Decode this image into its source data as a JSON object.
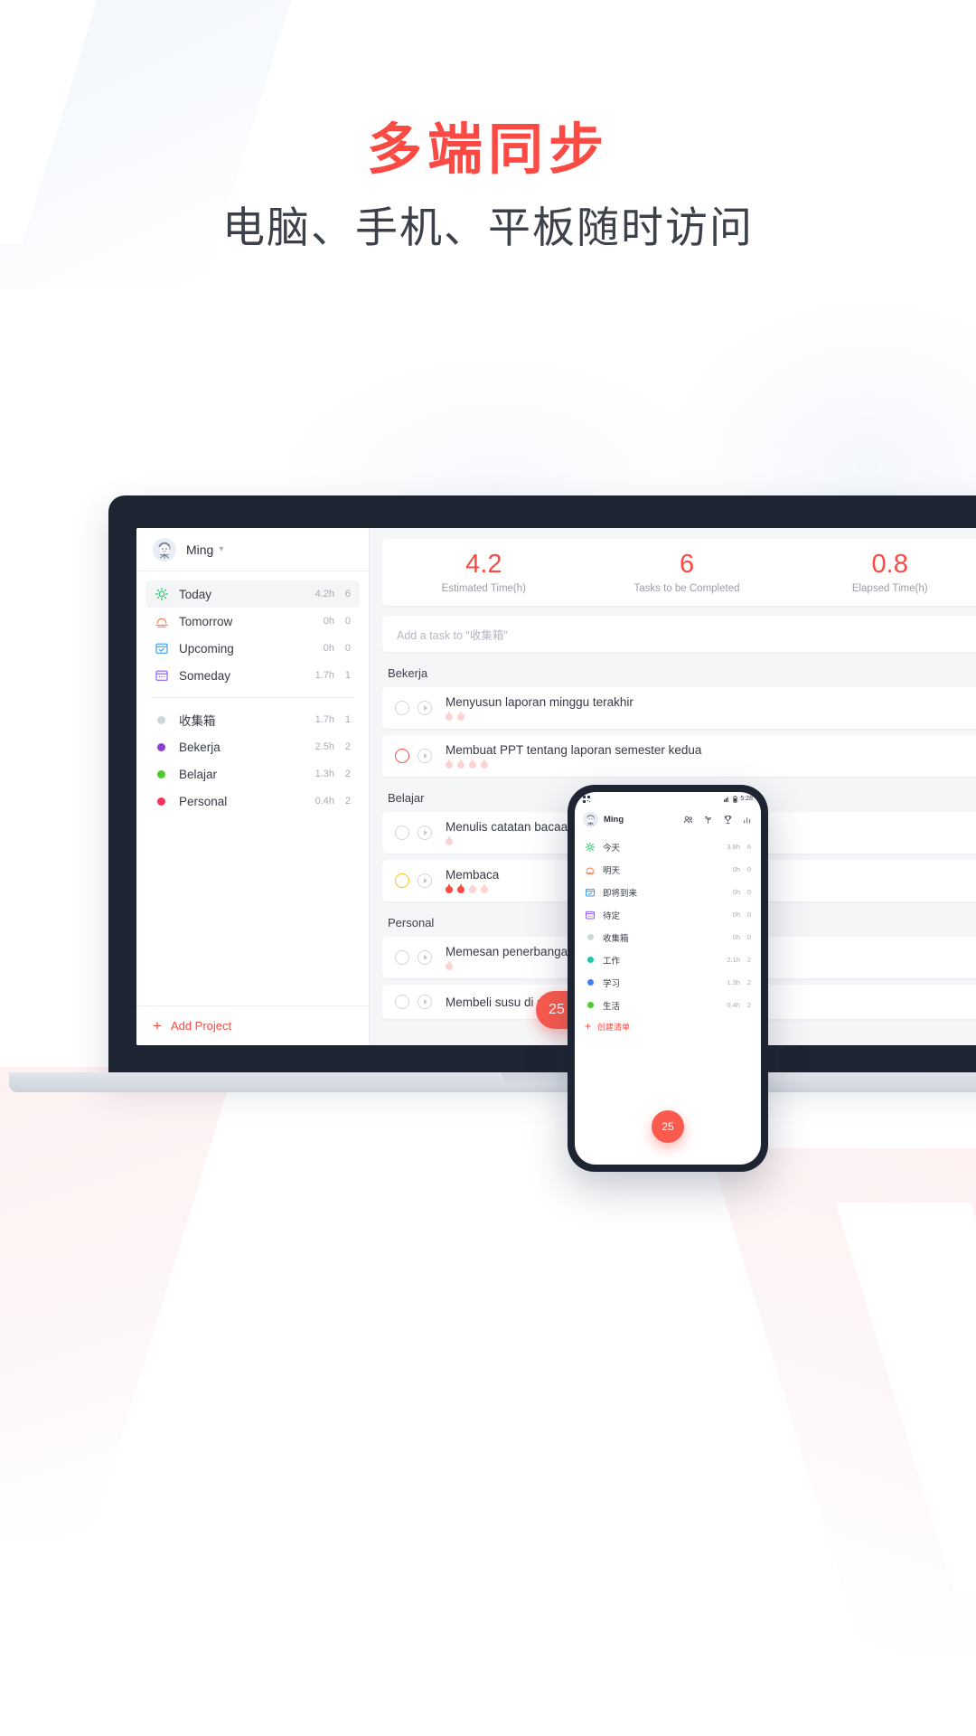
{
  "hero": {
    "title": "多端同步",
    "subtitle": "电脑、手机、平板随时访问"
  },
  "desktop": {
    "user": {
      "name": "Ming",
      "caret": "chevron-down-icon"
    },
    "smart_lists": [
      {
        "label": "Today",
        "icon": "sun-icon",
        "time": "4.2h",
        "count": "6",
        "active": true
      },
      {
        "label": "Tomorrow",
        "icon": "sunset-icon",
        "time": "0h",
        "count": "0",
        "active": false
      },
      {
        "label": "Upcoming",
        "icon": "calendar-check-icon",
        "time": "0h",
        "count": "0",
        "active": false
      },
      {
        "label": "Someday",
        "icon": "calendar-icon",
        "time": "1.7h",
        "count": "1",
        "active": false
      }
    ],
    "projects": [
      {
        "label": "收集箱",
        "color": "#ccd9db",
        "time": "1.7h",
        "count": "1"
      },
      {
        "label": "Bekerja",
        "color": "#8b3fd6",
        "time": "2.5h",
        "count": "2"
      },
      {
        "label": "Belajar",
        "color": "#4fcb2f",
        "time": "1.3h",
        "count": "2"
      },
      {
        "label": "Personal",
        "color": "#f7315e",
        "time": "0.4h",
        "count": "2"
      }
    ],
    "add_project": "Add Project",
    "stats": [
      {
        "value": "4.2",
        "caption": "Estimated Time(h)"
      },
      {
        "value": "6",
        "caption": "Tasks to be Completed"
      },
      {
        "value": "0.8",
        "caption": "Elapsed Time(h)"
      }
    ],
    "add_task_placeholder": "Add a task to \"收集箱\"",
    "groups": [
      {
        "title": "Bekerja",
        "tasks": [
          {
            "name": "Menyusun laporan minggu terakhir",
            "check": "grey",
            "pomodoros": 2,
            "filled": 0
          },
          {
            "name": "Membuat PPT tentang laporan semester kedua",
            "check": "red",
            "pomodoros": 4,
            "filled": 0
          }
        ]
      },
      {
        "title": "Belajar",
        "tasks": [
          {
            "name": "Menulis catatan bacaan",
            "check": "grey",
            "pomodoros": 1,
            "filled": 0
          },
          {
            "name": "Membaca",
            "check": "yellow",
            "pomodoros": 4,
            "filled": 2
          }
        ]
      },
      {
        "title": "Personal",
        "tasks": [
          {
            "name": "Memesan penerbangan ke Jepang",
            "check": "grey",
            "pomodoros": 1,
            "filled": 0
          },
          {
            "name": "Membeli susu di supermarket",
            "check": "grey",
            "pomodoros": 0,
            "filled": 0
          }
        ]
      }
    ],
    "timer_label": "25"
  },
  "phone": {
    "status": {
      "time": "5:28",
      "signal": "signal-icon",
      "battery": "battery-icon"
    },
    "user": {
      "name": "Ming"
    },
    "header_actions": [
      "people-icon",
      "tag-icon",
      "trophy-icon",
      "stats-icon"
    ],
    "lists": [
      {
        "label": "今天",
        "icon": "sun-icon",
        "time": "3.8h",
        "count": "6",
        "color": ""
      },
      {
        "label": "明天",
        "icon": "sunset-icon",
        "time": "0h",
        "count": "0",
        "color": ""
      },
      {
        "label": "即将到来",
        "icon": "calendar-check-icon",
        "time": "0h",
        "count": "0",
        "color": ""
      },
      {
        "label": "待定",
        "icon": "calendar-icon",
        "time": "0h",
        "count": "0",
        "color": ""
      },
      {
        "label": "收集箱",
        "icon": "dot",
        "time": "0h",
        "count": "0",
        "color": "#ccd9db"
      },
      {
        "label": "工作",
        "icon": "dot",
        "time": "2.1h",
        "count": "2",
        "color": "#1ec8a5"
      },
      {
        "label": "学习",
        "icon": "dot",
        "time": "1.3h",
        "count": "2",
        "color": "#3f7ff0"
      },
      {
        "label": "生活",
        "icon": "dot",
        "time": "0.4h",
        "count": "2",
        "color": "#4fcb2f"
      }
    ],
    "add_list": "创建清单",
    "timer_label": "25"
  },
  "colors": {
    "accent_red": "#fb4a43",
    "title_red": "#fb4a43",
    "text_dark": "#3c4049",
    "bezel": "#1e2431",
    "panel_bg": "#f5f6f8"
  }
}
